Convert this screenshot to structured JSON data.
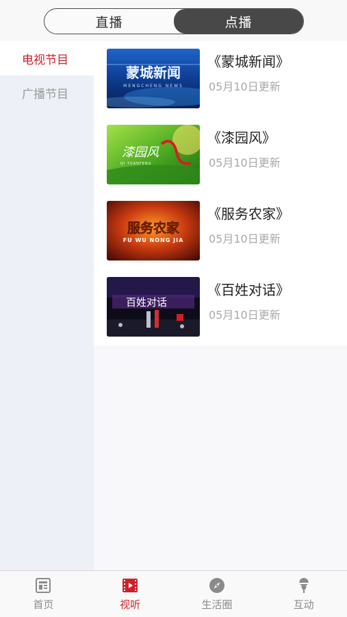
{
  "header": {
    "tabs": [
      {
        "label": "直播",
        "active": false
      },
      {
        "label": "点播",
        "active": true
      }
    ]
  },
  "sidebar": {
    "items": [
      {
        "label": "电视节目",
        "active": true
      },
      {
        "label": "广播节目",
        "active": false
      }
    ]
  },
  "programs": [
    {
      "title": "《蒙城新闻》",
      "updated": "05月10日更新",
      "thumb_text": "蒙城新闻",
      "thumb_sub": "MENGCHENG NEWS"
    },
    {
      "title": "《漆园风》",
      "updated": "05月10日更新",
      "thumb_text": "漆园风",
      "thumb_sub": "QI YUANFENG"
    },
    {
      "title": "《服务农家》",
      "updated": "05月10日更新",
      "thumb_text": "服务农家",
      "thumb_sub": "FU WU NONG JIA"
    },
    {
      "title": "《百姓对话》",
      "updated": "05月10日更新",
      "thumb_text": "百姓对话",
      "thumb_sub": ""
    }
  ],
  "tabbar": {
    "items": [
      {
        "label": "首页",
        "icon": "newspaper-icon",
        "active": false
      },
      {
        "label": "视听",
        "icon": "film-icon",
        "active": true
      },
      {
        "label": "生活圈",
        "icon": "compass-icon",
        "active": false
      },
      {
        "label": "互动",
        "icon": "microphone-icon",
        "active": false
      }
    ]
  },
  "colors": {
    "accent": "#d01f2a",
    "segment_active": "#484848",
    "sidebar_bg": "#edf0f7"
  }
}
